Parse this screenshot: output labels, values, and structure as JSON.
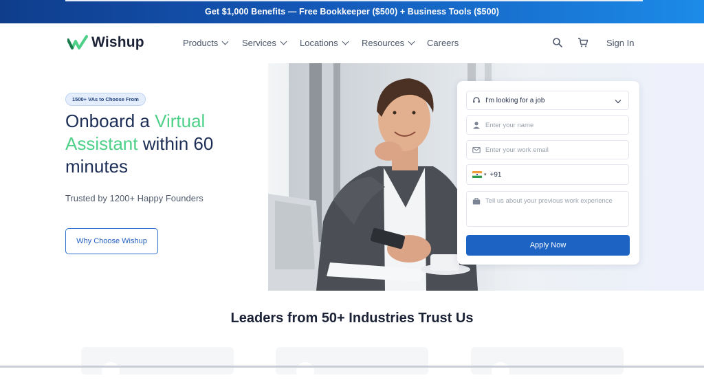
{
  "promo": {
    "text": "Get $1,000 Benefits — Free Bookkeeper ($500) + Business Tools ($500)"
  },
  "brand": {
    "name": "Wishup",
    "accent": "#4ed089",
    "primary": "#1d63c4"
  },
  "nav": {
    "items": [
      {
        "label": "Products",
        "has_dropdown": true
      },
      {
        "label": "Services",
        "has_dropdown": true
      },
      {
        "label": "Locations",
        "has_dropdown": true
      },
      {
        "label": "Resources",
        "has_dropdown": true
      },
      {
        "label": "Careers",
        "has_dropdown": false
      }
    ],
    "search_icon": "search-icon",
    "cart_icon": "cart-icon",
    "signin": "Sign In"
  },
  "hero": {
    "badge": "1500+ VAs to Choose From",
    "headline_1": "Onboard a ",
    "headline_accent": "Virtual Assistant",
    "headline_2": " within 60 minutes",
    "subtext": "Trusted by 1200+ Happy Founders",
    "cta": "Why Choose Wishup"
  },
  "form": {
    "role_select": "I'm looking for a job",
    "name_placeholder": "Enter your name",
    "email_placeholder": "Enter your work email",
    "phone_code": "+91",
    "experience_placeholder": "Tell us about your previous work experience",
    "submit": "Apply Now"
  },
  "trust": {
    "title": "Leaders from 50+ Industries Trust Us"
  }
}
